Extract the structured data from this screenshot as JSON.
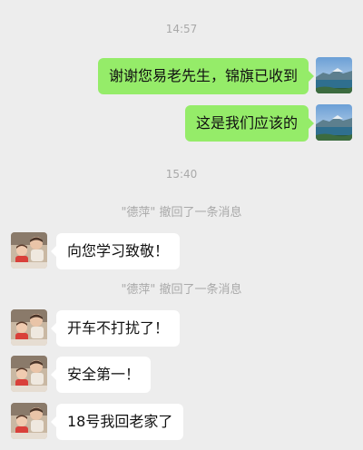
{
  "timestamps": {
    "first": "14:57",
    "second": "15:40"
  },
  "messages": {
    "out1": "谢谢您易老先生，锦旗已收到",
    "out2": "这是我们应该的",
    "in1": "向您学习致敬！",
    "in2": "开车不打扰了！",
    "in3": "安全第一！",
    "in4": "18号我回老家了"
  },
  "system_notes": {
    "recall1": "\"德萍\" 撤回了一条消息",
    "recall2": "\"德萍\" 撤回了一条消息"
  },
  "avatars": {
    "self": "landscape-lake-avatar",
    "contact": "family-photo-avatar"
  },
  "colors": {
    "background": "#ededed",
    "outgoing_bubble": "#95ec69",
    "incoming_bubble": "#ffffff",
    "meta_text": "#a9a9a9"
  }
}
